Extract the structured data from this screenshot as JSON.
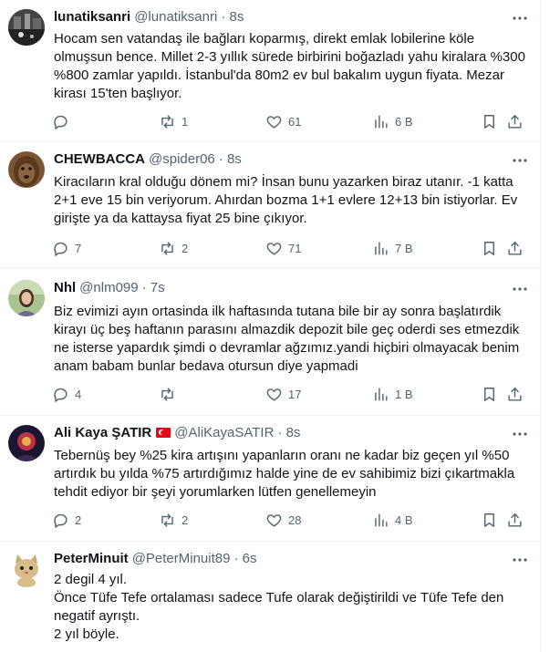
{
  "tweets": [
    {
      "name": "lunatiksanri",
      "handle": "@lunatiksanri",
      "time": "· 8s",
      "flag": false,
      "text": [
        "Hocam sen vatandaş ile bağları koparmış, direkt emlak lobilerine köle olmuşsun bence. Millet 2-3 yıllık sürede birbirini boğazladı yahu kiralara %300 %800 zamlar yapıldı. İstanbul'da 80m2 ev bul bakalım uygun fiyata. Mezar kirası 15'ten başlıyor."
      ],
      "replies": "",
      "retweets": "1",
      "likes": "61",
      "views": "6 B",
      "avatar_color": "#3a3a3a"
    },
    {
      "name": "CHEWBACCA",
      "handle": "@spider06",
      "time": "· 8s",
      "flag": false,
      "text": [
        "Kiracıların kral olduğu dönem mi? İnsan bunu yazarken biraz utanır. -1 katta 2+1 eve 15 bin veriyorum. Ahırdan bozma 1+1 evlere 12+13 bin istiyorlar. Ev girişte ya da kattaysa fiyat 25 bine çıkıyor."
      ],
      "replies": "7",
      "retweets": "2",
      "likes": "71",
      "views": "7 B",
      "avatar_color": "#6b4a2b"
    },
    {
      "name": "Nhl",
      "handle": "@nlm099",
      "time": "· 7s",
      "flag": false,
      "text": [
        "Biz evimizi ayın ortasinda ilk haftasında tutana bile bir ay sonra başlatırdik kirayı üç beş haftanın parasını almazdik depozit bile geç oderdi ses etmezdik ne isterse yapardık şimdi o devramlar ağzımız.yandi hiçbiri olmayacak benim anam babam bunlar bedava otursun diye yapmadi"
      ],
      "replies": "4",
      "retweets": "",
      "likes": "17",
      "views": "1 B",
      "avatar_color": "#8fae7a"
    },
    {
      "name": "Ali Kaya ŞATIR",
      "handle": "@AliKayaSATIR",
      "time": "· 8s",
      "flag": true,
      "text": [
        "Tebernüş bey %25 kira artışını yapanların oranı ne kadar biz geçen yıl %50 artırdık bu yılda %75 artırdığımız halde yine de ev sahibimiz bizi çıkartmakla tehdit ediyor bir şeyi yorumlarken lütfen genellemeyin"
      ],
      "replies": "2",
      "retweets": "2",
      "likes": "28",
      "views": "4 B",
      "avatar_color": "#2a1a3a"
    },
    {
      "name": "PeterMinuit",
      "handle": "@PeterMinuit89",
      "time": "· 6s",
      "flag": false,
      "text": [
        "2 degil 4 yıl.",
        "Önce Tüfe Tefe ortalaması sadece Tufe olarak değiştirildi ve Tüfe Tefe den negatif ayrıştı.",
        "2 yıl böyle."
      ],
      "replies": "",
      "retweets": "",
      "likes": "",
      "views": "",
      "avatar_color": "#e8d9b8"
    }
  ]
}
